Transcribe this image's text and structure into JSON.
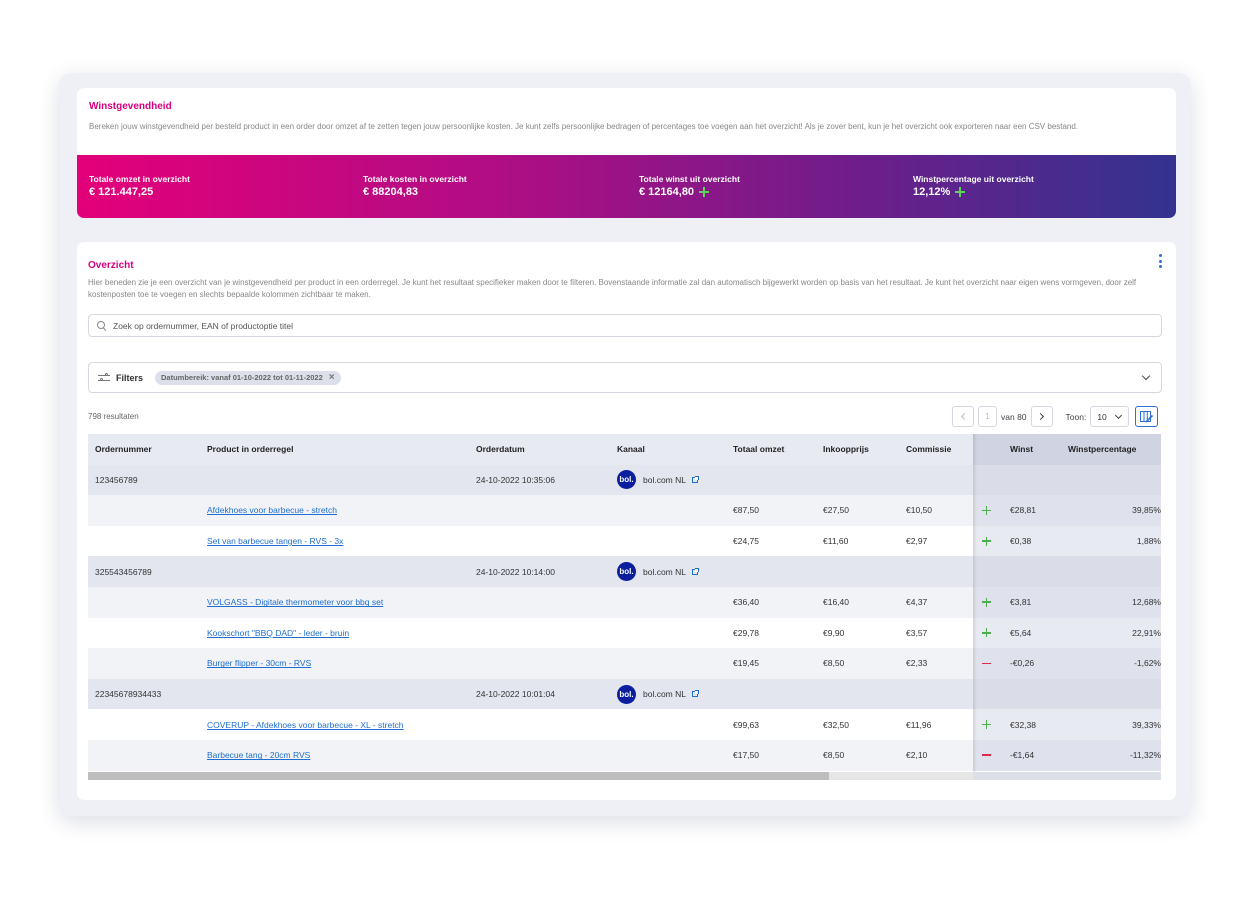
{
  "summary": {
    "title": "Winstgevendheid",
    "description": "Bereken jouw winstgevendheid per besteld product in een order door omzet af te zetten tegen jouw persoonlijke kosten. Je kunt zelfs persoonlijke bedragen of percentages toe voegen aan het overzicht! Als je zover bent, kun je het overzicht ook exporteren naar een CSV bestand.",
    "stats": [
      {
        "label": "Totale omzet in overzicht",
        "value": "€ 121.447,25"
      },
      {
        "label": "Totale kosten in overzicht",
        "value": "€ 88204,83"
      },
      {
        "label": "Totale winst uit overzicht",
        "value": "€ 12164,80"
      },
      {
        "label": "Winstpercentage uit overzicht",
        "value": "12,12%"
      }
    ]
  },
  "overview": {
    "title": "Overzicht",
    "description": "Hier beneden zie je een overzicht van je winstgevendheid per product in een orderregel. Je kunt het resultaat specifieker maken door te filteren. Bovenstaande informatie zal dan automatisch bijgewerkt worden op basis van het resultaat. Je kunt het overzicht naar eigen wens vormgeven, door zelf kostenposten toe te voegen en slechts bepaalde kolommen zichtbaar te maken.",
    "search_placeholder": "Zoek op ordernummer, EAN of productoptie titel",
    "filters_label": "Filters",
    "filter_chip": "Datumbereik: vanaf 01-10-2022 tot 01-11-2022",
    "results": "798 resultaten",
    "pagination": {
      "current": "1",
      "of_label": "van 80",
      "show_label": "Toon:",
      "per_page": "10"
    }
  },
  "table": {
    "headers": [
      "Ordernummer",
      "Product in orderregel",
      "Orderdatum",
      "Kanaal",
      "Totaal omzet",
      "Inkoopprijs",
      "Commissie",
      "Winst",
      "Winstpercentage"
    ],
    "rows": [
      {
        "type": "order",
        "order": "123456789",
        "date": "24-10-2022 10:35:06",
        "channel": "bol.com NL",
        "logo": "bol."
      },
      {
        "type": "line",
        "product": "Afdekhoes voor barbecue - stretch",
        "omzet": "€87,50",
        "inkoop": "€27,50",
        "commissie": "€10,50",
        "sign": "plus",
        "winst": "€28,81",
        "pct": "39,85%"
      },
      {
        "type": "line",
        "product": "Set van barbecue tangen - RVS - 3x",
        "omzet": "€24,75",
        "inkoop": "€11,60",
        "commissie": "€2,97",
        "sign": "plus",
        "winst": "€0,38",
        "pct": "1,88%"
      },
      {
        "type": "order",
        "order": "325543456789",
        "date": "24-10-2022 10:14:00",
        "channel": "bol.com NL",
        "logo": "bol."
      },
      {
        "type": "line",
        "product": "VOLGASS - Digitale thermometer voor bbq set",
        "omzet": "€36,40",
        "inkoop": "€16,40",
        "commissie": "€4,37",
        "sign": "plus",
        "winst": "€3,81",
        "pct": "12,68%"
      },
      {
        "type": "line",
        "product": "Kookschort \"BBQ DAD\" - leder - bruin",
        "omzet": "€29,78",
        "inkoop": "€9,90",
        "commissie": "€3,57",
        "sign": "plus",
        "winst": "€5,64",
        "pct": "22,91%"
      },
      {
        "type": "line",
        "product": "Burger flipper - 30cm - RVS",
        "omzet": "€19,45",
        "inkoop": "€8,50",
        "commissie": "€2,33",
        "sign": "minus",
        "winst": "-€0,26",
        "pct": "-1,62%"
      },
      {
        "type": "order",
        "order": "22345678934433",
        "date": "24-10-2022 10:01:04",
        "channel": "bol.com NL",
        "logo": "bol."
      },
      {
        "type": "line",
        "product": "COVERUP - Afdekhoes voor barbecue - XL - stretch",
        "omzet": "€99,63",
        "inkoop": "€32,50",
        "commissie": "€11,96",
        "sign": "plus",
        "winst": "€32,38",
        "pct": "39,33%"
      },
      {
        "type": "line",
        "product": "Barbecue tang - 20cm RVS",
        "omzet": "€17,50",
        "inkoop": "€8,50",
        "commissie": "€2,10",
        "sign": "minus",
        "winst": "-€1,64",
        "pct": "-11,32%"
      }
    ]
  },
  "colors": {
    "accent": "#d6007f",
    "link": "#1f6fd1",
    "positive": "#4cae4c",
    "negative": "#e0284c",
    "bol_brand": "#0a1e9e"
  }
}
